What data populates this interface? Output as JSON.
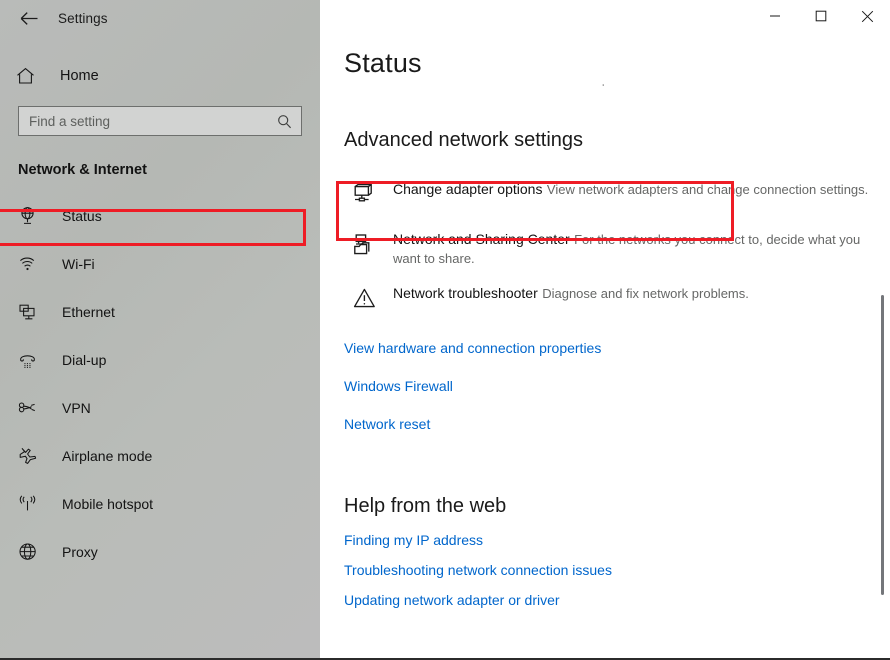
{
  "window": {
    "back_label": "back-arrow",
    "title": "Settings",
    "minimize": "—",
    "maximize": "□",
    "close": "✕"
  },
  "sidebar": {
    "home_label": "Home",
    "search": {
      "placeholder": "Find a setting",
      "value": "",
      "icon": "search-icon"
    },
    "category": "Network & Internet",
    "items": [
      {
        "label": "Status",
        "icon": "status-globe-icon",
        "selected": true
      },
      {
        "label": "Wi-Fi",
        "icon": "wifi-icon",
        "selected": false
      },
      {
        "label": "Ethernet",
        "icon": "ethernet-icon",
        "selected": false
      },
      {
        "label": "Dial-up",
        "icon": "dialup-phone-icon",
        "selected": false
      },
      {
        "label": "VPN",
        "icon": "vpn-key-icon",
        "selected": false
      },
      {
        "label": "Airplane mode",
        "icon": "airplane-icon",
        "selected": false
      },
      {
        "label": "Mobile hotspot",
        "icon": "hotspot-antenna-icon",
        "selected": false
      },
      {
        "label": "Proxy",
        "icon": "globe-icon",
        "selected": false
      }
    ]
  },
  "main": {
    "page_title": "Status",
    "ghost_fragment_1": "ı",
    "ghost_fragment_2": "ʹ",
    "advanced_heading": "Advanced network settings",
    "advanced_items": [
      {
        "title": "Change adapter options",
        "subtitle": "View network adapters and change connection settings.",
        "icon": "network-adapter-icon",
        "highlighted": true
      },
      {
        "title": "Network and Sharing Center",
        "subtitle": "For the networks you connect to, decide what you want to share.",
        "icon": "sharing-center-icon",
        "highlighted": false
      },
      {
        "title": "Network troubleshooter",
        "subtitle": "Diagnose and fix network problems.",
        "icon": "warning-triangle-icon",
        "highlighted": false
      }
    ],
    "links": [
      "View hardware and connection properties",
      "Windows Firewall",
      "Network reset"
    ],
    "help_heading": "Help from the web",
    "help_links": [
      "Finding my IP address",
      "Troubleshooting network connection issues",
      "Updating network adapter or driver"
    ]
  },
  "colors": {
    "annotation_red": "#ee1c25",
    "link_blue": "#0066cc",
    "sidebar_gray": "#b9bbb9"
  }
}
